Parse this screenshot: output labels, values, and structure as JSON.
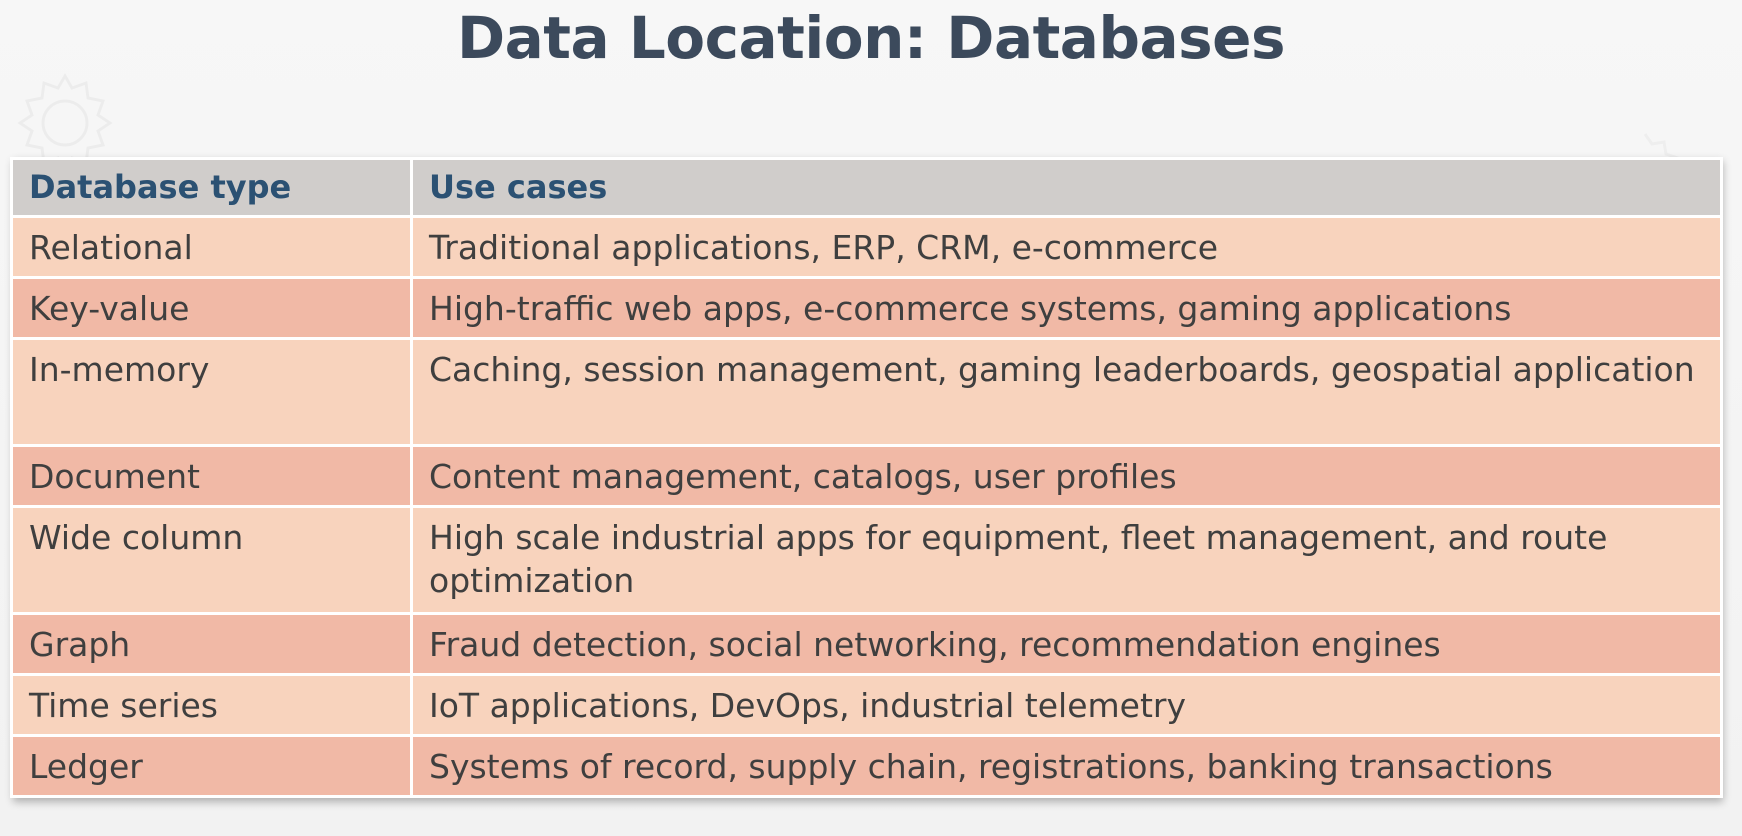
{
  "slide": {
    "title": "Data Location: Databases"
  },
  "table": {
    "headers": [
      "Database type",
      "Use cases"
    ],
    "rows": [
      {
        "type": "Relational",
        "use_cases": "Traditional applications, ERP, CRM, e-commerce"
      },
      {
        "type": "Key-value",
        "use_cases": "High-traffic web apps, e-commerce systems, gaming applications"
      },
      {
        "type": "In-memory",
        "use_cases": "Caching, session management, gaming leaderboards, geospatial application"
      },
      {
        "type": "Document",
        "use_cases": "Content management, catalogs, user profiles"
      },
      {
        "type": "Wide column",
        "use_cases": "High scale industrial apps for equipment, fleet management, and route optimization"
      },
      {
        "type": "Graph",
        "use_cases": "Fraud detection, social networking, recommendation engines"
      },
      {
        "type": "Time series",
        "use_cases": "IoT applications, DevOps, industrial telemetry"
      },
      {
        "type": "Ledger",
        "use_cases": "Systems of record, supply chain, registrations, banking transactions"
      }
    ]
  },
  "colors": {
    "title": "#3c4a5c",
    "header_bg": "#d0cdcb",
    "header_text": "#2b5173",
    "row_light": "#f8d3bd",
    "row_dark": "#f1b9a6"
  },
  "decorations": [
    "gear-icon"
  ]
}
